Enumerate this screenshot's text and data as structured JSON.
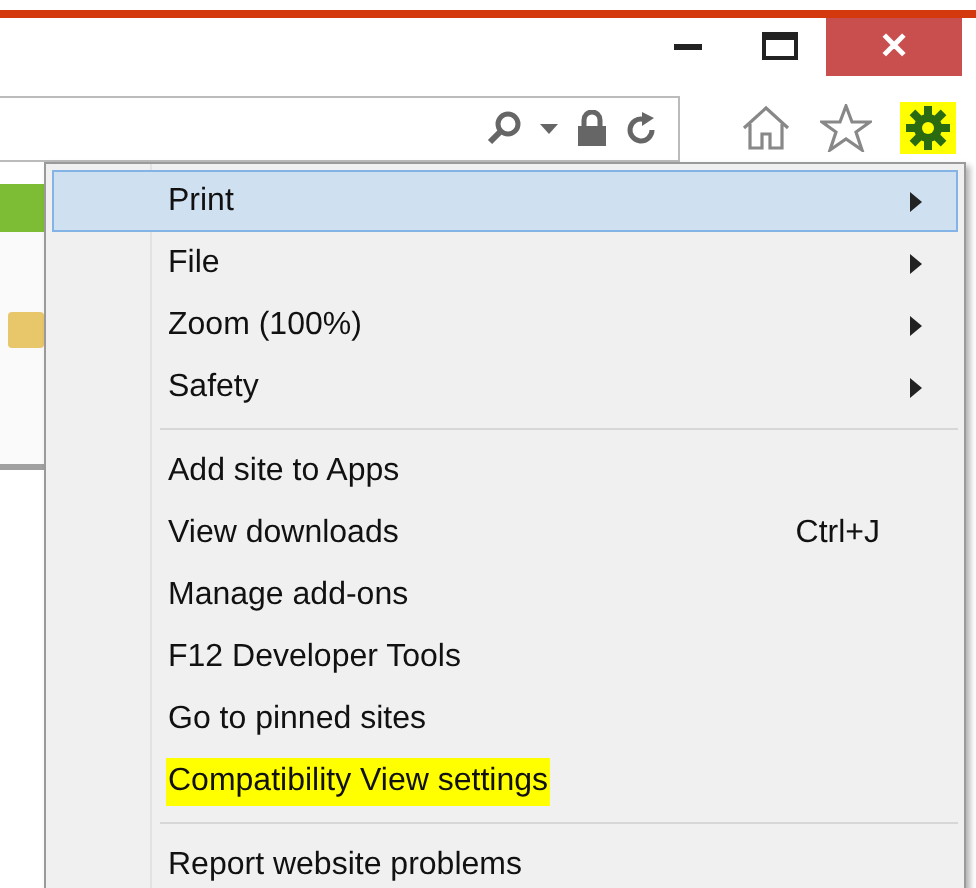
{
  "window": {
    "close_glyph": "✕"
  },
  "menu": {
    "groups": [
      [
        {
          "label": "Print",
          "submenu": true,
          "selected": true,
          "highlighted": false
        },
        {
          "label": "File",
          "submenu": true,
          "selected": false,
          "highlighted": false
        },
        {
          "label": "Zoom (100%)",
          "submenu": true,
          "selected": false,
          "highlighted": false
        },
        {
          "label": "Safety",
          "submenu": true,
          "selected": false,
          "highlighted": false
        }
      ],
      [
        {
          "label": "Add site to Apps",
          "submenu": false,
          "selected": false,
          "highlighted": false
        },
        {
          "label": "View downloads",
          "shortcut": "Ctrl+J",
          "submenu": false,
          "selected": false,
          "highlighted": false
        },
        {
          "label": "Manage add-ons",
          "submenu": false,
          "selected": false,
          "highlighted": false
        },
        {
          "label": "F12 Developer Tools",
          "submenu": false,
          "selected": false,
          "highlighted": false
        },
        {
          "label": "Go to pinned sites",
          "submenu": false,
          "selected": false,
          "highlighted": false
        },
        {
          "label": "Compatibility View settings",
          "submenu": false,
          "selected": false,
          "highlighted": true
        }
      ],
      [
        {
          "label": "Report website problems",
          "submenu": false,
          "selected": false,
          "highlighted": false
        }
      ]
    ]
  }
}
